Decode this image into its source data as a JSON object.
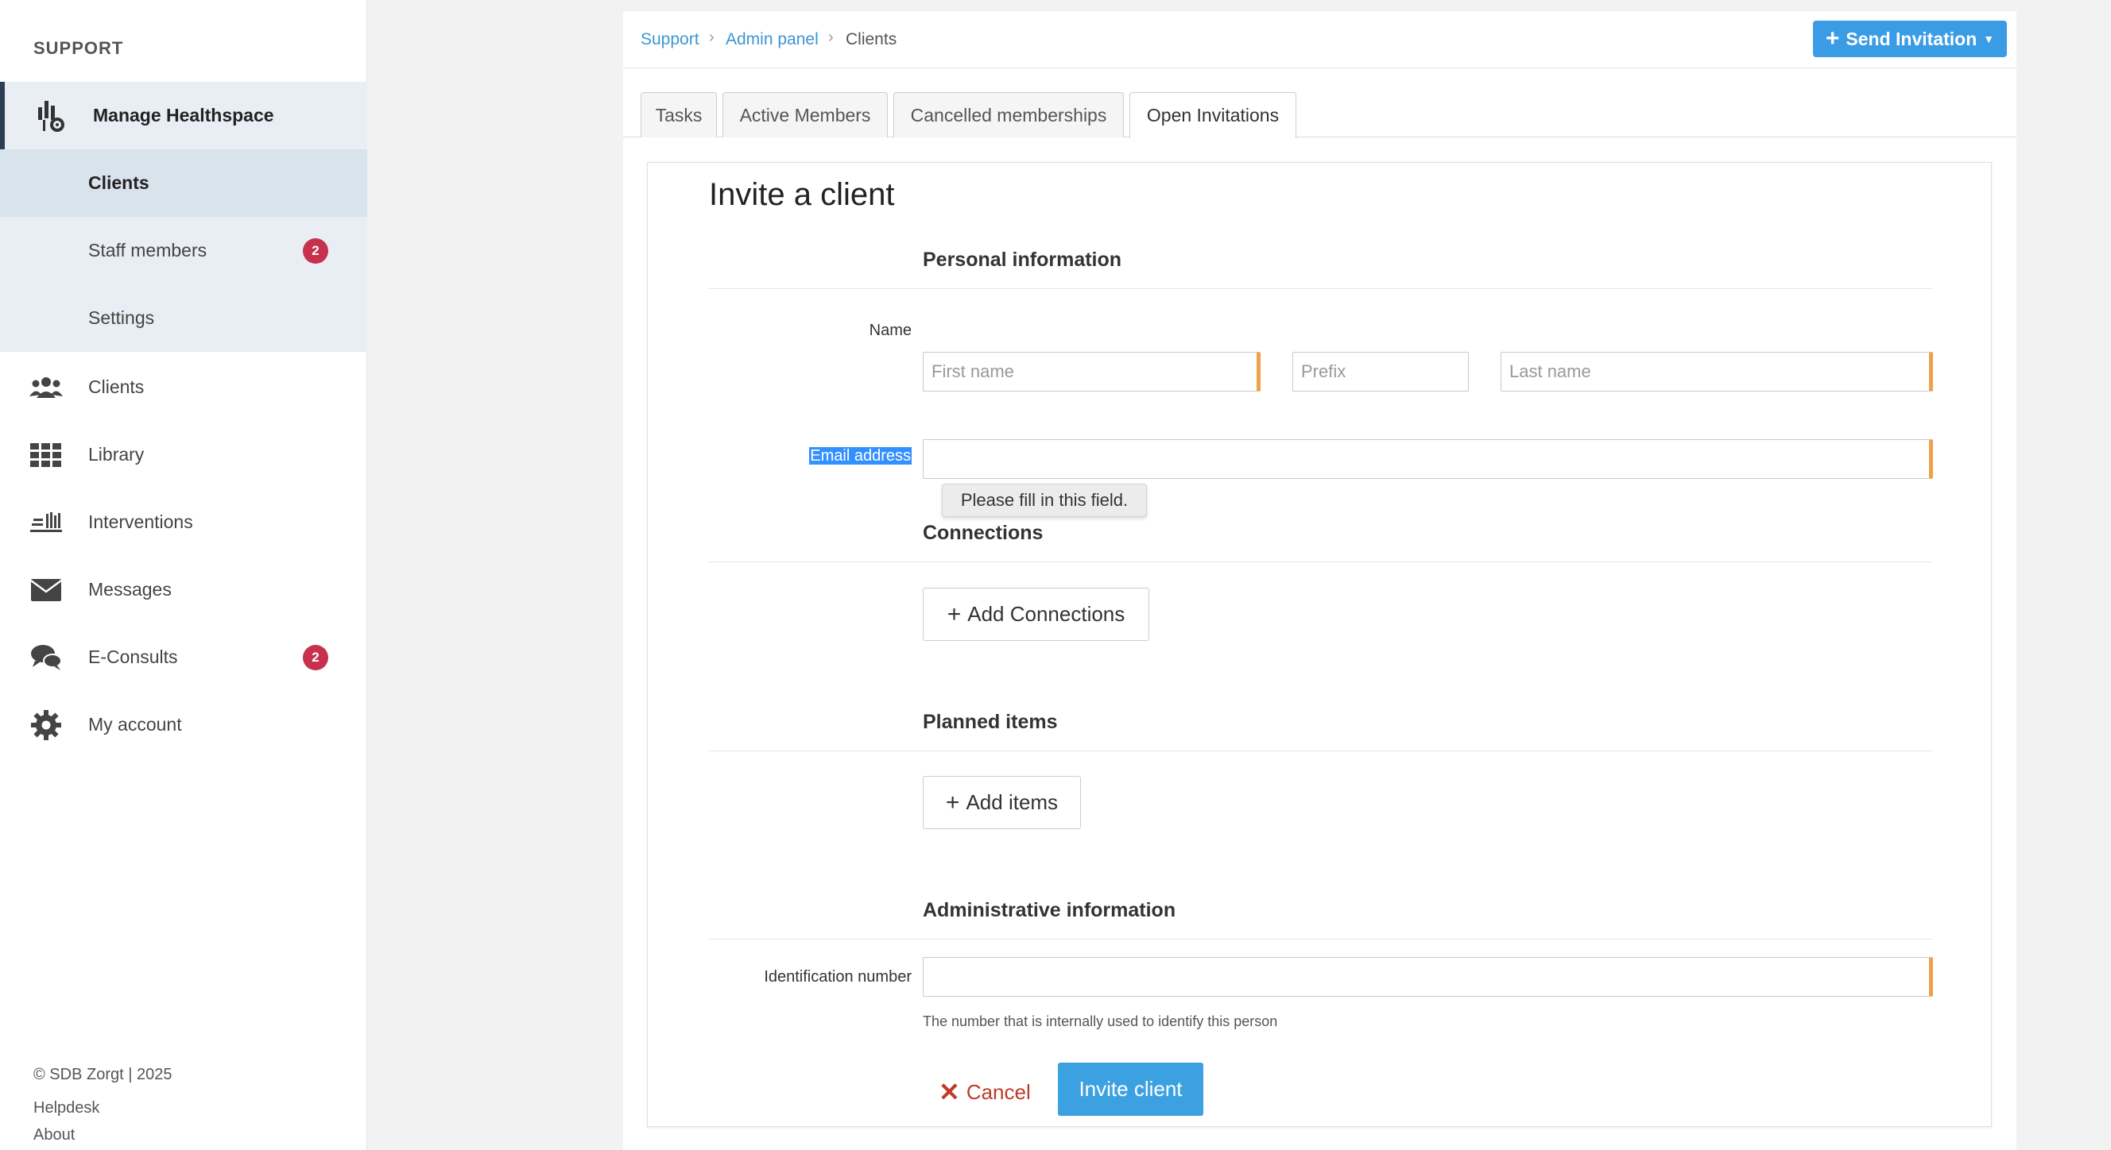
{
  "sidebar": {
    "brand": "SUPPORT",
    "manage": {
      "label": "Manage Healthspace",
      "icon": "healthspace-settings-icon"
    },
    "sub_items": [
      {
        "label": "Clients",
        "active": true
      },
      {
        "label": "Staff members",
        "badge": "2"
      },
      {
        "label": "Settings"
      }
    ],
    "items": [
      {
        "label": "Clients",
        "icon": "users-icon"
      },
      {
        "label": "Library",
        "icon": "grid-icon"
      },
      {
        "label": "Interventions",
        "icon": "interventions-icon"
      },
      {
        "label": "Messages",
        "icon": "envelope-icon"
      },
      {
        "label": "E-Consults",
        "icon": "chat-icon",
        "badge": "2"
      },
      {
        "label": "My account",
        "icon": "gear-icon"
      }
    ],
    "footer": {
      "copyright": "© SDB Zorgt | 2025",
      "helpdesk": "Helpdesk",
      "about": "About"
    }
  },
  "breadcrumb": {
    "support": "Support",
    "admin": "Admin panel",
    "current": "Clients"
  },
  "send_button": "Send Invitation",
  "tabs": [
    {
      "label": "Tasks"
    },
    {
      "label": "Active Members"
    },
    {
      "label": "Cancelled memberships"
    },
    {
      "label": "Open Invitations",
      "active": true
    }
  ],
  "form": {
    "title": "Invite a client",
    "personal_heading": "Personal information",
    "name_label": "Name",
    "first_name_placeholder": "First name",
    "prefix_placeholder": "Prefix",
    "last_name_placeholder": "Last name",
    "email_label": "Email address",
    "email_value": "",
    "tooltip": "Please fill in this field.",
    "connections_heading": "Connections",
    "add_connections": "Add Connections",
    "planned_heading": "Planned items",
    "add_items": "Add items",
    "admin_heading": "Administrative information",
    "id_label": "Identification number",
    "id_value": "",
    "id_help": "The number that is internally used to identify this person",
    "cancel": "Cancel",
    "invite": "Invite client"
  },
  "colors": {
    "primary": "#3b9ce6",
    "badge": "#c8314e",
    "required": "#f0a04b",
    "cancel": "#c0392b"
  }
}
